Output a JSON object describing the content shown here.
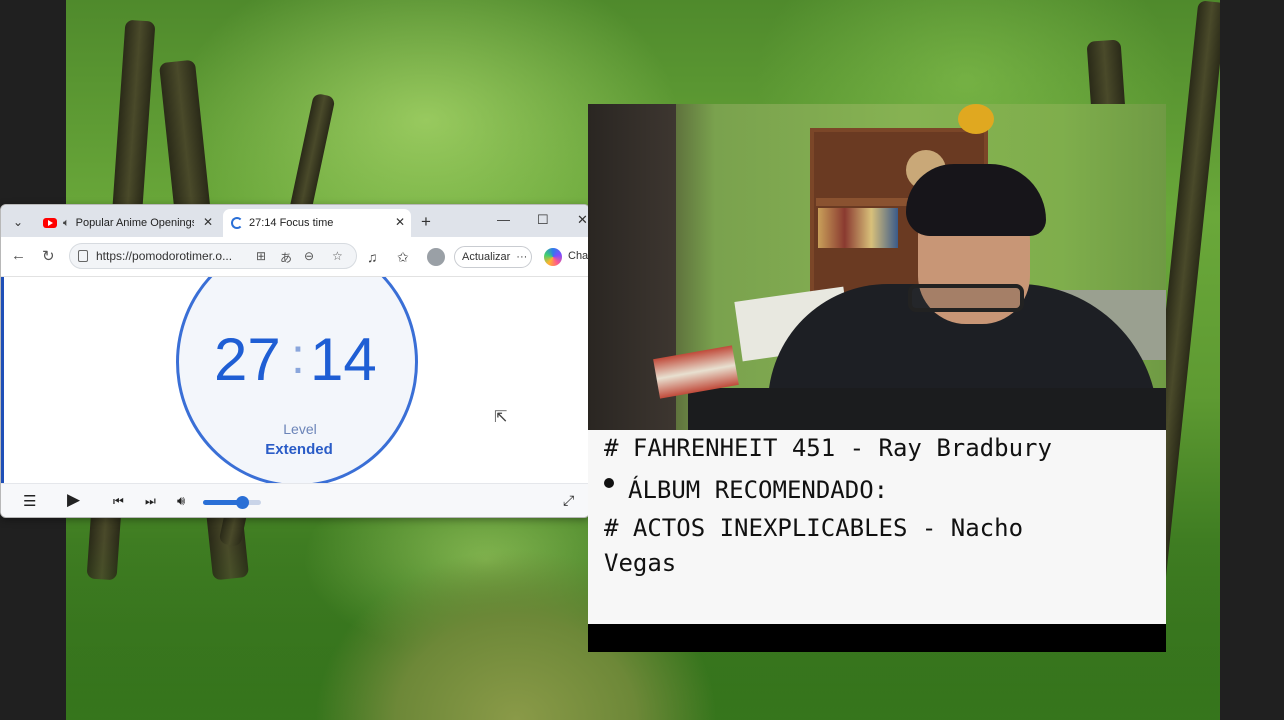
{
  "browser": {
    "tabs": [
      {
        "label": "Popular Anime Openings",
        "has_audio": true
      },
      {
        "label": "27:14 Focus time",
        "active": true
      }
    ],
    "url": "https://pomodorotimer.o...",
    "update_button": "Actualizar",
    "chat_label": "Chat"
  },
  "timer": {
    "minutes": "27",
    "colon": ":",
    "seconds": "14",
    "level_label": "Level",
    "level_value": "Extended"
  },
  "player": {
    "volume_fraction": 0.68
  },
  "overlay": {
    "line1": "# FAHRENHEIT 451 - Ray Bradbury",
    "line2": "ÁLBUM RECOMENDADO:",
    "line3": "# ACTOS INEXPLICABLES - Nacho",
    "line4": "Vegas"
  },
  "colors": {
    "accent": "#1f5ed4",
    "forest": "#5e9a32"
  }
}
